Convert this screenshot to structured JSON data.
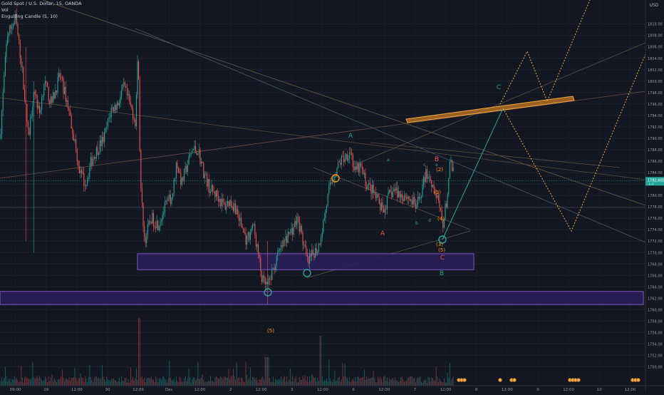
{
  "legend": {
    "symbol": "Gold Spot / U.S. Dollar, 15, OANDA",
    "volume": "Vol",
    "indicator": "Engulfing Candle (5, 10)"
  },
  "colors": {
    "background": "#131722",
    "bull": "#26a69a",
    "bear": "#ef5350",
    "zone_fill": "#2a1f5c",
    "zone_stroke": "#7e57c2",
    "wave_green": "#26a69a",
    "wave_red": "#ef5350",
    "wave_orange": "#ff9800",
    "projection": "#f2a93b",
    "resistance_band": "#c77a1f"
  },
  "chart_data": {
    "type": "candlestick",
    "title": "",
    "xlabel": "",
    "ylabel": "",
    "currency": "USD",
    "ylim": [
      1746.7,
      1814.2
    ],
    "y_ticks": [
      1750,
      1752,
      1754,
      1756,
      1758,
      1760,
      1762,
      1764,
      1766,
      1768,
      1770,
      1772,
      1774,
      1776,
      1778,
      1780,
      1782,
      1784,
      1786,
      1788,
      1790,
      1792,
      1794,
      1796,
      1798,
      1800,
      1802,
      1804,
      1806,
      1808,
      1810
    ],
    "y_tick_labels": [
      "1750.00",
      "1752.00",
      "1754.00",
      "1756.00",
      "1758.00",
      "1760.00",
      "1762.00",
      "1764.00",
      "1766.00",
      "1768.00",
      "1770.00",
      "1772.00",
      "1774.00",
      "1776.00",
      "1778.00",
      "1780.00",
      "1782.00",
      "1784.00",
      "1786.00",
      "1788.00",
      "1790.00",
      "1792.00",
      "1794.00",
      "1796.00",
      "1798.00",
      "1800.00",
      "1802.00",
      "1804.00",
      "1806.00",
      "1808.00",
      "1810.00"
    ],
    "x_tick_labels": [
      "09:00",
      "29",
      "12:00",
      "30",
      "12:00",
      "Dec",
      "12:00",
      "2",
      "12:00",
      "3",
      "12:00",
      "6",
      "12:00",
      "7",
      "12:00",
      "8",
      "12:00",
      "9",
      "12:00",
      "10",
      "12:00"
    ],
    "x_tick_index": [
      1,
      3,
      5,
      7,
      9,
      11,
      13,
      15,
      17,
      19,
      21,
      23,
      25,
      27,
      29,
      31,
      33,
      35,
      37,
      39,
      41
    ],
    "x_ticks_total": 42,
    "last_price": "1782.600",
    "countdown": "(--)",
    "price_path": [
      [
        0,
        1790
      ],
      [
        10,
        1808
      ],
      [
        22,
        1811
      ],
      [
        32,
        1801
      ],
      [
        40,
        1790
      ],
      [
        48,
        1799
      ],
      [
        55,
        1794
      ],
      [
        62,
        1800
      ],
      [
        72,
        1796
      ],
      [
        84,
        1801
      ],
      [
        95,
        1796
      ],
      [
        104,
        1790
      ],
      [
        112,
        1784
      ],
      [
        120,
        1782
      ],
      [
        128,
        1786
      ],
      [
        136,
        1788
      ],
      [
        146,
        1790
      ],
      [
        156,
        1795
      ],
      [
        165,
        1796
      ],
      [
        174,
        1799
      ],
      [
        182,
        1796
      ],
      [
        190,
        1793
      ],
      [
        194,
        1806
      ],
      [
        197,
        1782
      ],
      [
        203,
        1772
      ],
      [
        212,
        1776
      ],
      [
        222,
        1775
      ],
      [
        232,
        1778
      ],
      [
        242,
        1780
      ],
      [
        248,
        1786
      ],
      [
        255,
        1782
      ],
      [
        262,
        1785
      ],
      [
        270,
        1788
      ],
      [
        278,
        1788
      ],
      [
        286,
        1784
      ],
      [
        295,
        1781
      ],
      [
        305,
        1780
      ],
      [
        315,
        1778
      ],
      [
        322,
        1779
      ],
      [
        330,
        1778
      ],
      [
        338,
        1775
      ],
      [
        346,
        1772
      ],
      [
        355,
        1775
      ],
      [
        362,
        1770
      ],
      [
        368,
        1765
      ],
      [
        376,
        1764
      ],
      [
        383,
        1767
      ],
      [
        392,
        1770
      ],
      [
        400,
        1772
      ],
      [
        410,
        1774
      ],
      [
        418,
        1776
      ],
      [
        425,
        1772
      ],
      [
        432,
        1768
      ],
      [
        440,
        1770
      ],
      [
        447,
        1771
      ],
      [
        455,
        1776
      ],
      [
        462,
        1781
      ],
      [
        470,
        1784
      ],
      [
        478,
        1786
      ],
      [
        486,
        1787
      ],
      [
        492,
        1788
      ],
      [
        498,
        1784
      ],
      [
        506,
        1785
      ],
      [
        514,
        1782
      ],
      [
        522,
        1781
      ],
      [
        530,
        1779
      ],
      [
        538,
        1777
      ],
      [
        546,
        1780
      ],
      [
        554,
        1781
      ],
      [
        562,
        1780
      ],
      [
        570,
        1780
      ],
      [
        578,
        1779
      ],
      [
        585,
        1778
      ],
      [
        592,
        1781
      ],
      [
        598,
        1784
      ],
      [
        604,
        1783
      ],
      [
        610,
        1781
      ],
      [
        616,
        1778
      ],
      [
        622,
        1775
      ],
      [
        628,
        1780
      ],
      [
        632,
        1786
      ],
      [
        638,
        1783
      ]
    ],
    "volume_hint": "spikes near Nov 30 12:00 and Dec 3 12:00",
    "zones": [
      {
        "label": "",
        "price_top": 1769.8,
        "price_bottom": 1767.0
      },
      {
        "label": "",
        "price_top": 1763.2,
        "price_bottom": 1760.9
      }
    ],
    "annotations": [
      {
        "text": "A",
        "color": "green"
      },
      {
        "text": "C",
        "color": "green"
      },
      {
        "text": "B",
        "color": "red"
      },
      {
        "text": "A",
        "color": "red"
      },
      {
        "text": "C",
        "color": "red"
      },
      {
        "text": "B",
        "color": "green"
      },
      {
        "text": "a",
        "color": "green"
      },
      {
        "text": "b",
        "color": "green"
      },
      {
        "text": "c",
        "color": "green"
      },
      {
        "text": "d",
        "color": "green"
      },
      {
        "text": "e",
        "color": "green"
      },
      {
        "text": "(2)",
        "color": "orange"
      },
      {
        "text": "(1)",
        "color": "orange"
      },
      {
        "text": "(4)",
        "color": "orange"
      },
      {
        "text": "(3)",
        "color": "orange"
      },
      {
        "text": "(5)",
        "color": "orange"
      },
      {
        "text": "(5)",
        "color": "orange"
      }
    ]
  }
}
